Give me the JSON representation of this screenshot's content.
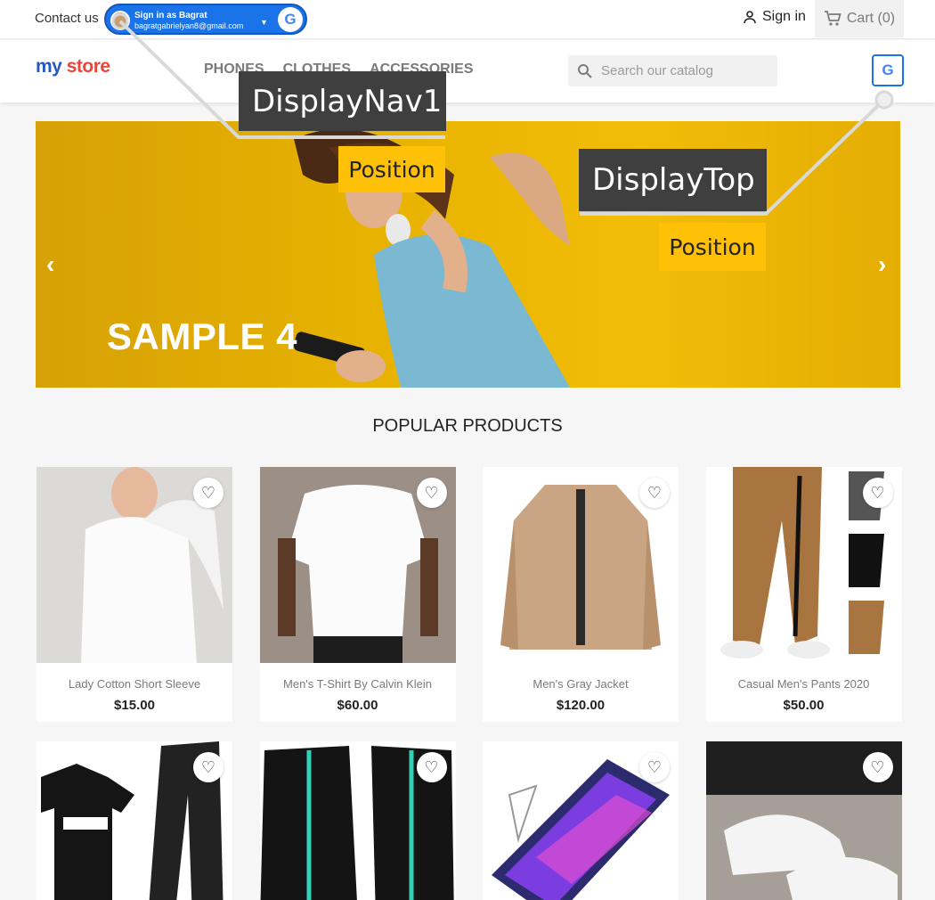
{
  "topbar": {
    "contact": "Contact us",
    "google_signin": {
      "line1": "Sign in as Bagrat",
      "line2": "bagratgabrielyan8@gmail.com",
      "logo": "G"
    },
    "signin": "Sign in",
    "cart": "Cart (0)"
  },
  "header": {
    "logo_part1": "my",
    "logo_part2": "store",
    "menu": [
      "PHONES",
      "CLOTHES",
      "ACCESSORIES"
    ],
    "search_placeholder": "Search our catalog",
    "google_button": "G"
  },
  "hero": {
    "title": "SAMPLE 4",
    "prev": "‹",
    "next": "›"
  },
  "annotations": {
    "nav_label": "DisplayNav1",
    "nav_position": "Position",
    "top_label": "DisplayTop",
    "top_position": "Position"
  },
  "products": {
    "title": "POPULAR PRODUCTS",
    "items": [
      {
        "name": "Lady Cotton Short Sleeve",
        "price": "$15.00",
        "img": "white-top-woman"
      },
      {
        "name": "Men's T-Shirt By Calvin Klein",
        "price": "$60.00",
        "img": "white-tshirt-man"
      },
      {
        "name": "Men's Gray Jacket",
        "price": "$120.00",
        "img": "beige-jacket"
      },
      {
        "name": "Casual Men's Pants 2020",
        "price": "$50.00",
        "img": "brown-pants"
      },
      {
        "name": "",
        "price": "",
        "img": "lonsdale-set"
      },
      {
        "name": "",
        "price": "",
        "img": "black-tracksuit"
      },
      {
        "name": "",
        "price": "",
        "img": "phone-screen-protector"
      },
      {
        "name": "",
        "price": "",
        "img": "white-sneakers"
      }
    ]
  },
  "colors": {
    "accent_blue": "#1a73e8",
    "annotation_dark": "#3f3f3f",
    "annotation_yellow": "#ffc107",
    "hero_yellow": "#e8b300"
  }
}
